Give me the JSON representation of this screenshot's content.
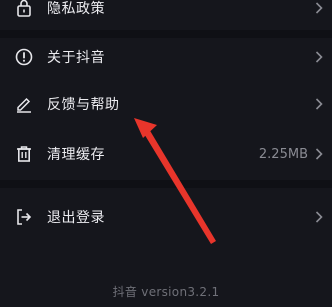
{
  "settings": {
    "items": [
      {
        "icon": "lock-icon",
        "label": "隐私政策"
      },
      {
        "icon": "info-circle-icon",
        "label": "关于抖音"
      },
      {
        "icon": "pencil-icon",
        "label": "反馈与帮助"
      },
      {
        "icon": "trash-icon",
        "label": "清理缓存",
        "value": "2.25MB"
      },
      {
        "icon": "logout-icon",
        "label": "退出登录"
      }
    ]
  },
  "footer": {
    "version_text": "抖音 version3.2.1"
  },
  "colors": {
    "background": "#15161c",
    "text": "#ececf0",
    "muted": "#8a8b93",
    "annotation_arrow": "#e8352b"
  }
}
